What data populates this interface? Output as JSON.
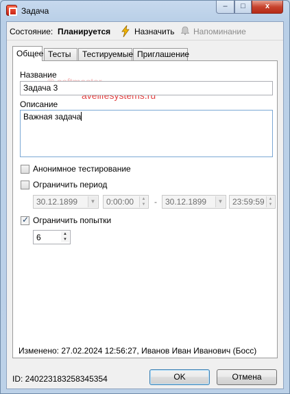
{
  "window": {
    "title": "Задача",
    "controls": {
      "minimize": "–",
      "maximize": "□",
      "close": "x"
    }
  },
  "status": {
    "label": "Состояние:",
    "value": "Планируется",
    "assign_label": "Назначить",
    "reminder_label": "Напоминание"
  },
  "tabs": [
    {
      "label": "Общее",
      "active": true
    },
    {
      "label": "Тесты",
      "active": false
    },
    {
      "label": "Тестируемые",
      "active": false
    },
    {
      "label": "Приглашение",
      "active": false
    }
  ],
  "watermark": {
    "line1": "© softmaster",
    "line2": "avelifesystems.ru"
  },
  "form": {
    "name_label": "Название",
    "name_value": "Задача 3",
    "description_label": "Описание",
    "description_value": "Важная задача",
    "anonymous_label": "Анонимное тестирование",
    "anonymous_checked": false,
    "limit_period_label": "Ограничить период",
    "limit_period_checked": false,
    "period_start_date": "30.12.1899",
    "period_start_time": "0:00:00",
    "period_separator": "-",
    "period_end_date": "30.12.1899",
    "period_end_time": "23:59:59",
    "limit_attempts_label": "Ограничить попытки",
    "limit_attempts_checked": true,
    "attempts_value": "6"
  },
  "modified_text": "Изменено: 27.02.2024 12:56:27, Иванов Иван Иванович (Босс)",
  "footer": {
    "id_text": "ID: 240223183258345354",
    "ok_label": "OK",
    "cancel_label": "Отмена"
  },
  "colors": {
    "titlebar": "#bcd1e8",
    "close_button": "#c7432e",
    "assign_icon": "#f2b600",
    "watermark": "#dd2222"
  }
}
